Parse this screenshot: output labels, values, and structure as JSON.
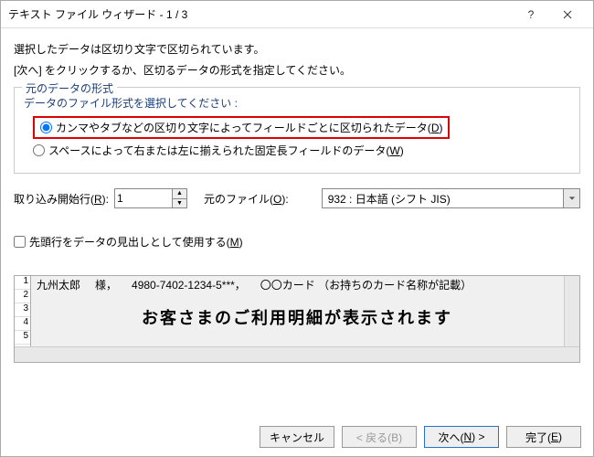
{
  "title": "テキスト ファイル ウィザード - 1 / 3",
  "msg1": "選択したデータは区切り文字で区切られています。",
  "msg2": "[次へ] をクリックするか、区切るデータの形式を指定してください。",
  "legend": "元のデータの形式",
  "fileTypePrompt": "データのファイル形式を選択してください :",
  "radio1_pre": "カンマやタブなどの区切り文字によってフィールドごとに区切られたデータ(",
  "radio1_u": "D",
  "radio1_post": ")",
  "radio2_pre": "スペースによって右または左に揃えられた固定長フィールドのデータ(",
  "radio2_u": "W",
  "radio2_post": ")",
  "startRow_pre": "取り込み開始行(",
  "startRow_u": "R",
  "startRow_post": "):",
  "startRowValue": "1",
  "origin_pre": "元のファイル(",
  "origin_u": "O",
  "origin_post": "):",
  "originValue": "932 : 日本語 (シフト JIS)",
  "header_pre": "先頭行をデータの見出しとして使用する(",
  "header_u": "M",
  "header_post": ")",
  "preview": {
    "rows": [
      "1",
      "2",
      "3",
      "4",
      "5"
    ],
    "c1": "九州太郎",
    "c2": "様，",
    "c3": "4980-7402-1234-5***，",
    "c4": "〇〇カード （お持ちのカード名称が記載）",
    "big": "お客さまのご利用明細が表示されます"
  },
  "btn": {
    "cancel": "キャンセル",
    "back": "< 戻る(B)",
    "next_pre": "次へ(",
    "next_u": "N",
    "next_post": ") >",
    "finish_pre": "完了(",
    "finish_u": "E",
    "finish_post": ")"
  }
}
